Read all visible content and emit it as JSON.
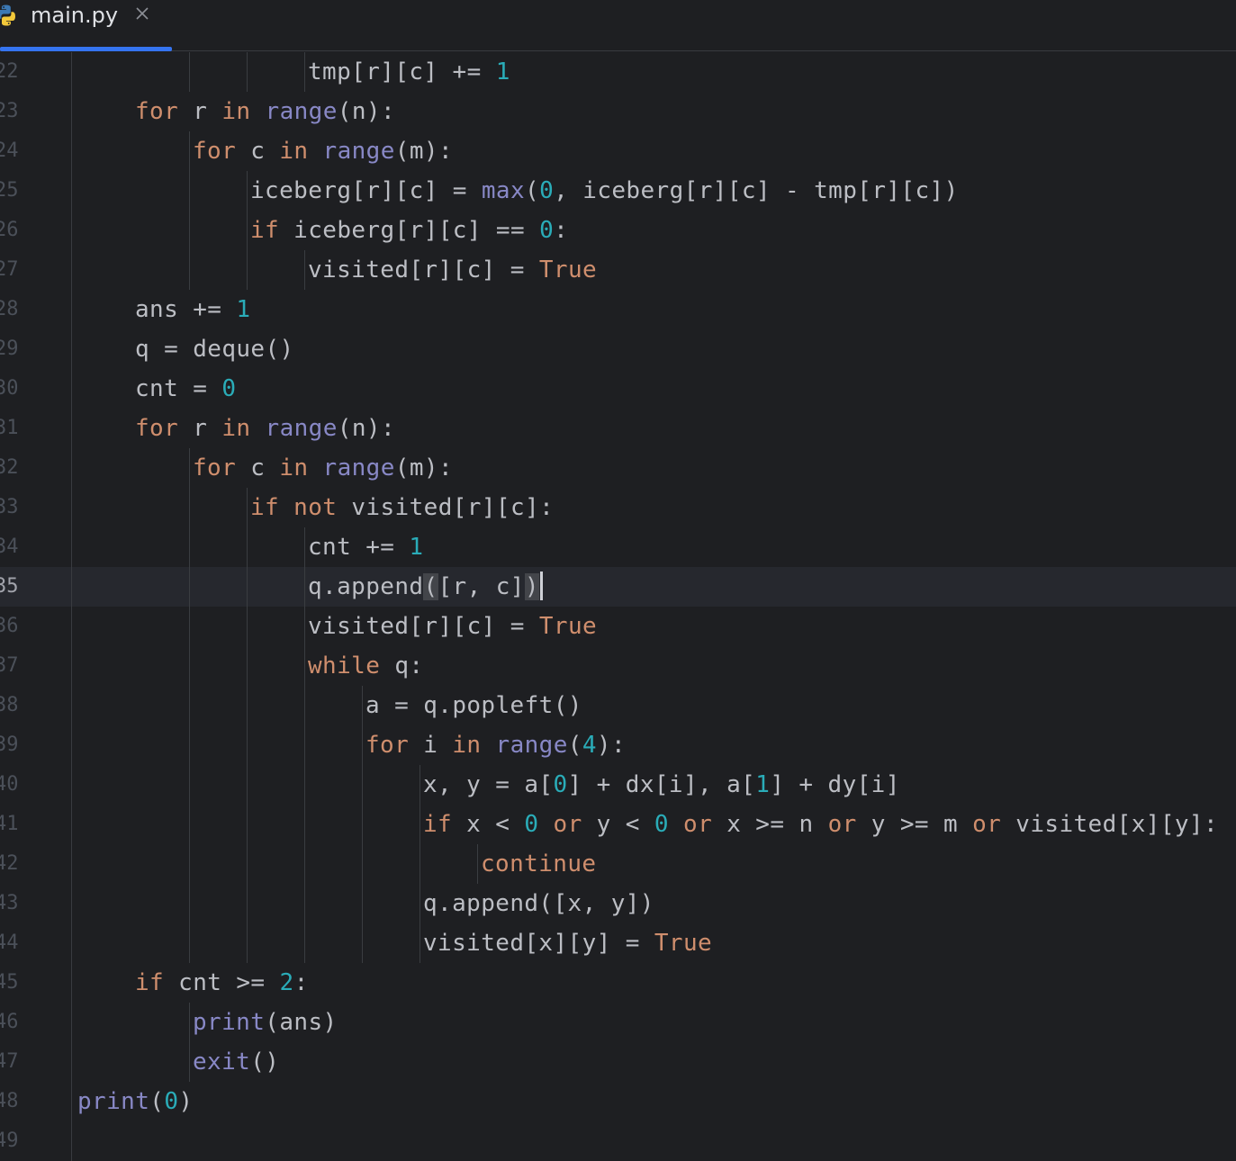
{
  "tab": {
    "filename": "main.py",
    "icon": "python-icon",
    "close_icon": "close-icon"
  },
  "colors": {
    "background": "#1e1f22",
    "keyword": "#cf8e6d",
    "builtin": "#8888c6",
    "number": "#2aacb8",
    "text": "#bcbec4",
    "tab_accent": "#3574f0"
  },
  "editor": {
    "active_line": "35",
    "lines": [
      {
        "n": "22",
        "indent": 4,
        "tokens": [
          [
            "p",
            "tmp[r][c] += "
          ],
          [
            "num",
            "1"
          ]
        ]
      },
      {
        "n": "23",
        "indent": 1,
        "tokens": [
          [
            "kw",
            "for"
          ],
          [
            "p",
            " r "
          ],
          [
            "kw",
            "in"
          ],
          [
            "p",
            " "
          ],
          [
            "bi",
            "range"
          ],
          [
            "p",
            "(n):"
          ]
        ]
      },
      {
        "n": "24",
        "indent": 2,
        "tokens": [
          [
            "kw",
            "for"
          ],
          [
            "p",
            " c "
          ],
          [
            "kw",
            "in"
          ],
          [
            "p",
            " "
          ],
          [
            "bi",
            "range"
          ],
          [
            "p",
            "(m):"
          ]
        ]
      },
      {
        "n": "25",
        "indent": 3,
        "tokens": [
          [
            "p",
            "iceberg[r][c] = "
          ],
          [
            "bi",
            "max"
          ],
          [
            "p",
            "("
          ],
          [
            "num",
            "0"
          ],
          [
            "p",
            ", iceberg[r][c] - tmp[r][c])"
          ]
        ]
      },
      {
        "n": "26",
        "indent": 3,
        "tokens": [
          [
            "kw",
            "if"
          ],
          [
            "p",
            " iceberg[r][c] == "
          ],
          [
            "num",
            "0"
          ],
          [
            "p",
            ":"
          ]
        ]
      },
      {
        "n": "27",
        "indent": 4,
        "tokens": [
          [
            "p",
            "visited[r][c] = "
          ],
          [
            "kw",
            "True"
          ]
        ]
      },
      {
        "n": "28",
        "indent": 1,
        "tokens": [
          [
            "p",
            "ans += "
          ],
          [
            "num",
            "1"
          ]
        ]
      },
      {
        "n": "29",
        "indent": 1,
        "tokens": [
          [
            "p",
            "q = deque()"
          ]
        ]
      },
      {
        "n": "30",
        "indent": 1,
        "tokens": [
          [
            "p",
            "cnt = "
          ],
          [
            "num",
            "0"
          ]
        ]
      },
      {
        "n": "31",
        "indent": 1,
        "tokens": [
          [
            "kw",
            "for"
          ],
          [
            "p",
            " r "
          ],
          [
            "kw",
            "in"
          ],
          [
            "p",
            " "
          ],
          [
            "bi",
            "range"
          ],
          [
            "p",
            "(n):"
          ]
        ]
      },
      {
        "n": "32",
        "indent": 2,
        "tokens": [
          [
            "kw",
            "for"
          ],
          [
            "p",
            " c "
          ],
          [
            "kw",
            "in"
          ],
          [
            "p",
            " "
          ],
          [
            "bi",
            "range"
          ],
          [
            "p",
            "(m):"
          ]
        ]
      },
      {
        "n": "33",
        "indent": 3,
        "tokens": [
          [
            "kw",
            "if not"
          ],
          [
            "p",
            " visited[r][c]:"
          ]
        ]
      },
      {
        "n": "34",
        "indent": 4,
        "tokens": [
          [
            "p",
            "cnt += "
          ],
          [
            "num",
            "1"
          ]
        ]
      },
      {
        "n": "35",
        "indent": 4,
        "tokens": [
          [
            "p",
            "q.append"
          ],
          [
            "bm",
            "("
          ],
          [
            "p",
            "[r, c]"
          ],
          [
            "bm",
            ")"
          ],
          [
            "cursor",
            ""
          ]
        ]
      },
      {
        "n": "36",
        "indent": 4,
        "tokens": [
          [
            "p",
            "visited[r][c] = "
          ],
          [
            "kw",
            "True"
          ]
        ]
      },
      {
        "n": "37",
        "indent": 4,
        "tokens": [
          [
            "kw",
            "while"
          ],
          [
            "p",
            " q:"
          ]
        ]
      },
      {
        "n": "38",
        "indent": 5,
        "tokens": [
          [
            "p",
            "a = q.popleft()"
          ]
        ]
      },
      {
        "n": "39",
        "indent": 5,
        "tokens": [
          [
            "kw",
            "for"
          ],
          [
            "p",
            " i "
          ],
          [
            "kw",
            "in"
          ],
          [
            "p",
            " "
          ],
          [
            "bi",
            "range"
          ],
          [
            "p",
            "("
          ],
          [
            "num",
            "4"
          ],
          [
            "p",
            "):"
          ]
        ]
      },
      {
        "n": "40",
        "indent": 6,
        "tokens": [
          [
            "p",
            "x, y = a["
          ],
          [
            "num",
            "0"
          ],
          [
            "p",
            "] + dx[i], a["
          ],
          [
            "num",
            "1"
          ],
          [
            "p",
            "] + dy[i]"
          ]
        ]
      },
      {
        "n": "41",
        "indent": 6,
        "tokens": [
          [
            "kw",
            "if"
          ],
          [
            "p",
            " x < "
          ],
          [
            "num",
            "0"
          ],
          [
            "p",
            " "
          ],
          [
            "kw",
            "or"
          ],
          [
            "p",
            " y < "
          ],
          [
            "num",
            "0"
          ],
          [
            "p",
            " "
          ],
          [
            "kw",
            "or"
          ],
          [
            "p",
            " x >= n "
          ],
          [
            "kw",
            "or"
          ],
          [
            "p",
            " y >= m "
          ],
          [
            "kw",
            "or"
          ],
          [
            "p",
            " visited[x][y]:"
          ]
        ]
      },
      {
        "n": "42",
        "indent": 7,
        "tokens": [
          [
            "kw",
            "continue"
          ]
        ]
      },
      {
        "n": "43",
        "indent": 6,
        "tokens": [
          [
            "p",
            "q.append([x, y])"
          ]
        ]
      },
      {
        "n": "44",
        "indent": 6,
        "tokens": [
          [
            "p",
            "visited[x][y] = "
          ],
          [
            "kw",
            "True"
          ]
        ]
      },
      {
        "n": "45",
        "indent": 1,
        "tokens": [
          [
            "kw",
            "if"
          ],
          [
            "p",
            " cnt >= "
          ],
          [
            "num",
            "2"
          ],
          [
            "p",
            ":"
          ]
        ]
      },
      {
        "n": "46",
        "indent": 2,
        "tokens": [
          [
            "bi",
            "print"
          ],
          [
            "p",
            "(ans)"
          ]
        ]
      },
      {
        "n": "47",
        "indent": 2,
        "tokens": [
          [
            "bi",
            "exit"
          ],
          [
            "p",
            "()"
          ]
        ]
      },
      {
        "n": "48",
        "indent": 0,
        "tokens": [
          [
            "bi",
            "print"
          ],
          [
            "p",
            "("
          ],
          [
            "num",
            "0"
          ],
          [
            "p",
            ")"
          ]
        ]
      },
      {
        "n": "49",
        "indent": 0,
        "tokens": []
      }
    ]
  }
}
